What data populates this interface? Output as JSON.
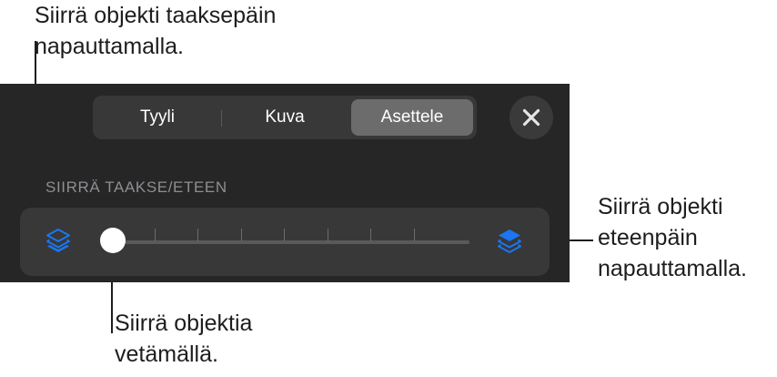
{
  "callouts": {
    "back": [
      "Siirrä objekti taaksepäin",
      "napauttamalla."
    ],
    "forward": [
      "Siirrä objekti",
      "eteenpäin",
      "napauttamalla."
    ],
    "drag": [
      "Siirrä objektia",
      "vetämällä."
    ]
  },
  "tabs": [
    {
      "label": "Tyyli",
      "selected": false
    },
    {
      "label": "Kuva",
      "selected": false
    },
    {
      "label": "Asettele",
      "selected": true
    }
  ],
  "section": {
    "title": "SIIRRÄ TAAKSE/ETEEN"
  },
  "slider": {
    "value": 0,
    "tick_count": 7
  },
  "icons": {
    "close": "close-icon",
    "back": "send-backward-icon",
    "forward": "bring-forward-icon"
  },
  "colors": {
    "accent": "#1a76f2",
    "panel": "#262626",
    "selected_tab": "#6c6c6c"
  }
}
